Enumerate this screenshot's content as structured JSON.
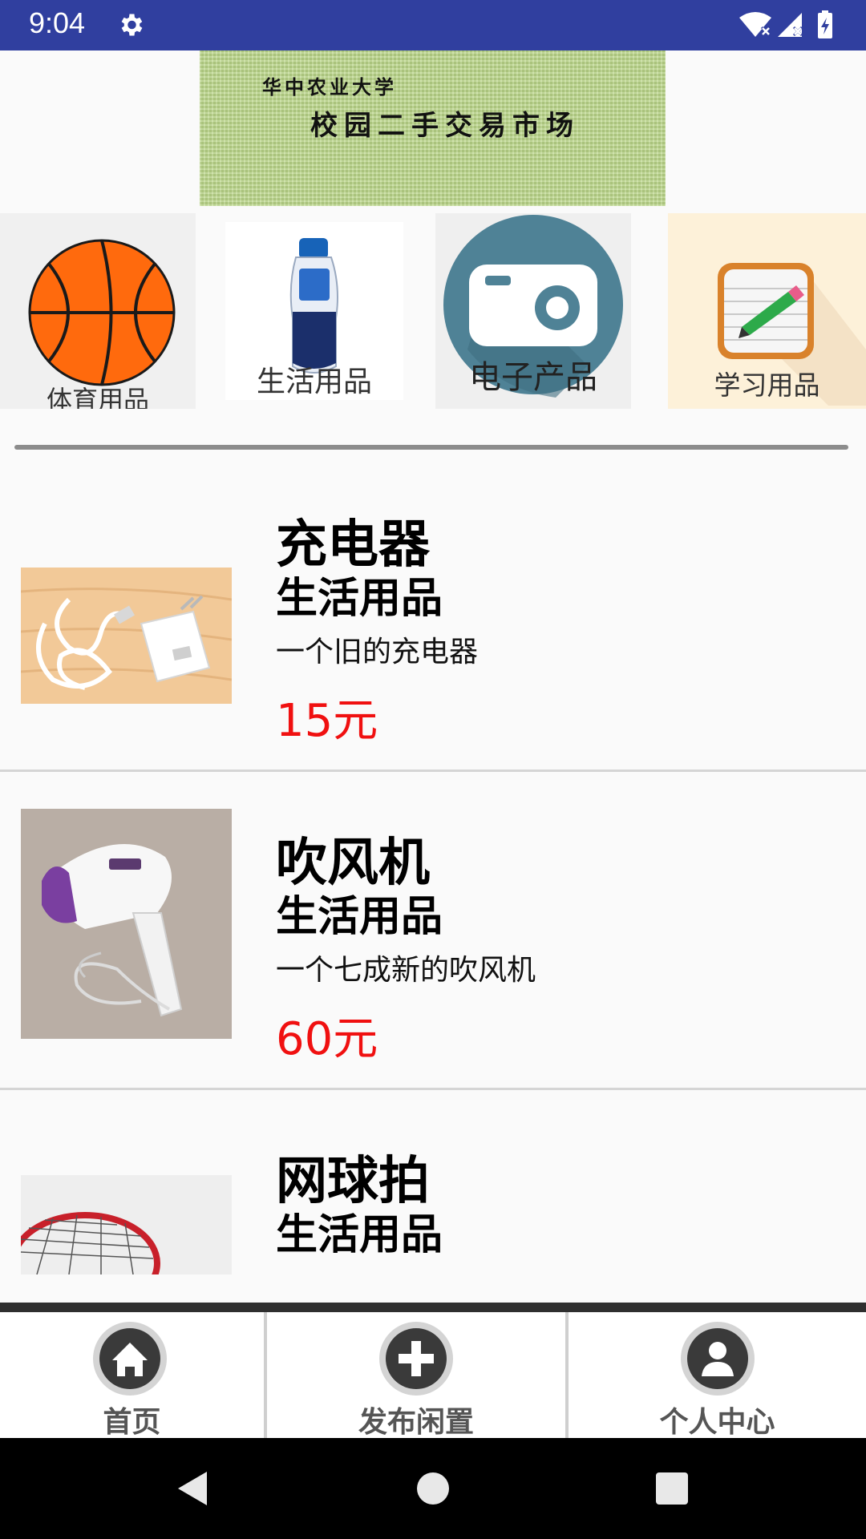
{
  "status_bar": {
    "time": "9:04",
    "bg_color": "#303f9f",
    "icons": [
      "gear-icon",
      "wifi-icon",
      "signal-icon",
      "battery-icon"
    ]
  },
  "banner": {
    "university": "华中农业大学",
    "title": "校园二手交易市场"
  },
  "categories": [
    {
      "label": "体育用品",
      "icon": "basketball-icon"
    },
    {
      "label": "生活用品",
      "icon": "shampoo-icon"
    },
    {
      "label": "电子产品",
      "icon": "camera-icon"
    },
    {
      "label": "学习用品",
      "icon": "notebook-icon"
    }
  ],
  "items": [
    {
      "name": "充电器",
      "category": "生活用品",
      "description": "一个旧的充电器",
      "price": "15元",
      "image": "charger-image"
    },
    {
      "name": "吹风机",
      "category": "生活用品",
      "description": "一个七成新的吹风机",
      "price": "60元",
      "image": "hair-dryer-image"
    },
    {
      "name": "网球拍",
      "category": "生活用品",
      "image": "tennis-racket-image"
    }
  ],
  "bottom_nav": [
    {
      "label": "首页",
      "icon": "home-icon"
    },
    {
      "label": "发布闲置",
      "icon": "add-icon"
    },
    {
      "label": "个人中心",
      "icon": "person-icon"
    }
  ],
  "colors": {
    "price": "#f01010",
    "accent": "#303f9f"
  },
  "system_nav": [
    "back-button",
    "home-button",
    "recents-button"
  ]
}
